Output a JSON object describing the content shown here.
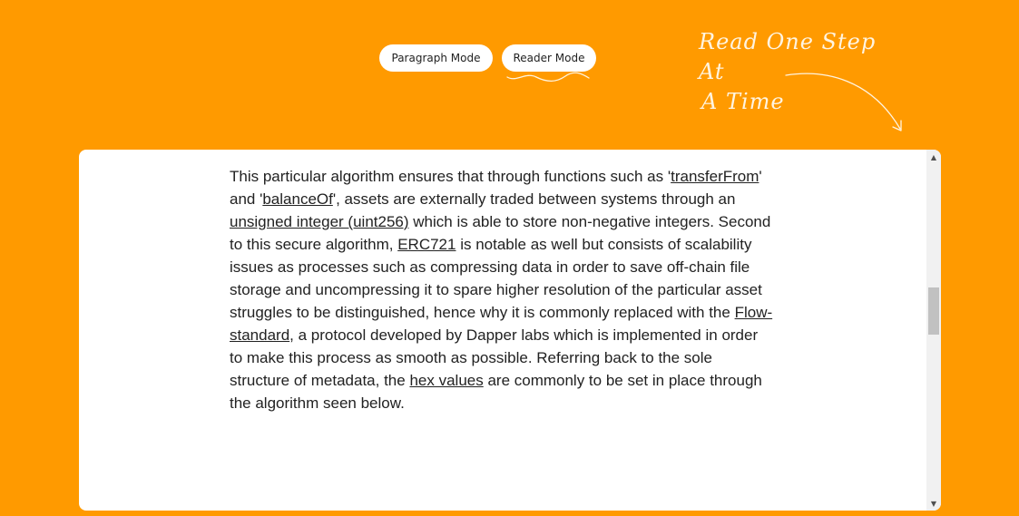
{
  "toolbar": {
    "paragraph_mode_label": "Paragraph Mode",
    "reader_mode_label": "Reader Mode"
  },
  "tagline": {
    "line1": "Read One Step At",
    "line2": "A Time"
  },
  "article": {
    "parts": {
      "p0": "This particular algorithm ensures that through functions such as '",
      "l0": "transferFrom",
      "p1": "' and '",
      "l1": "balanceOf",
      "p2": "', assets are externally traded between systems through an ",
      "l2": "unsigned integer (uint256)",
      "p3": " which is able to store non-negative integers. Second to this secure algorithm, ",
      "l3": "ERC721",
      "p4": " is notable as well but consists of scalability issues as processes such as compressing data in order to save off-chain file storage and uncompressing it to spare higher resolution of the particular asset struggles to be distinguished, hence why it is commonly replaced with the ",
      "l4": "Flow-standard",
      "p5": ", a protocol developed by Dapper labs which is implemented in order to make this process as smooth as possible. Referring back to the sole structure of metadata, the ",
      "l5": "hex values",
      "p6": " are commonly to be set in place through the algorithm seen below."
    }
  },
  "scrollbar": {
    "up_icon": "▲",
    "down_icon": "▼",
    "position": 0.38
  },
  "colors": {
    "background": "#ff9a00",
    "card": "#ffffff",
    "text": "#222222"
  }
}
